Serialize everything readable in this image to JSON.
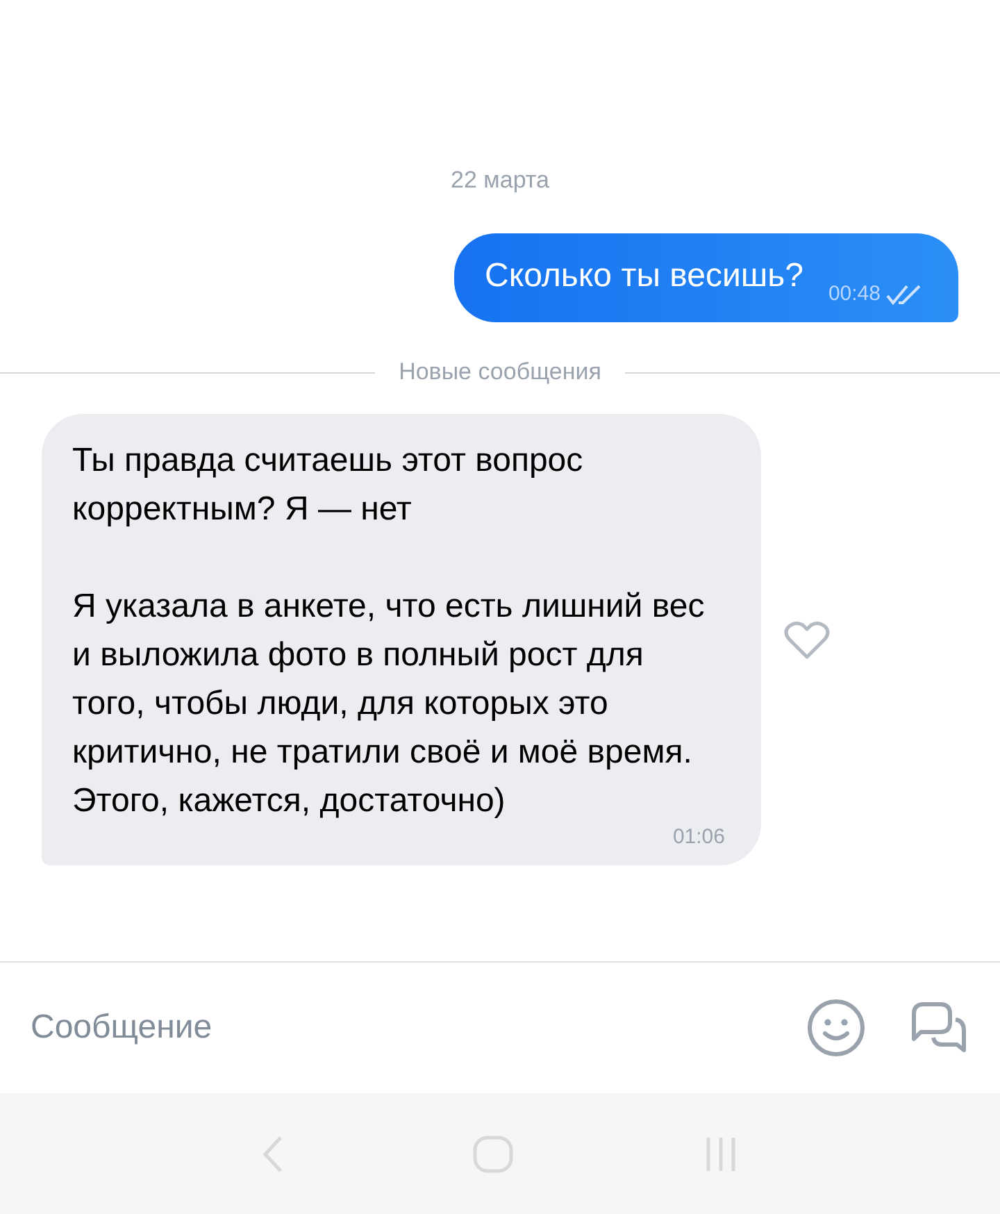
{
  "date_separator": "22 марта",
  "messages": [
    {
      "kind": "outgoing",
      "paragraphs": [
        "Сколько ты весишь?"
      ],
      "time": "00:48",
      "read": true
    },
    {
      "kind": "divider",
      "label": "Новые сообщения"
    },
    {
      "kind": "incoming",
      "paragraphs": [
        "Ты правда считаешь этот вопрос корректным? Я — нет",
        "Я указала в анкете, что есть лишний вес и выложила фото в полный рост для того, чтобы люди, для которых это критично, не тратили своё и моё время. Этого, кажется, достаточно)"
      ],
      "time": "01:06",
      "liked": false
    }
  ],
  "composer": {
    "placeholder": "Сообщение"
  }
}
